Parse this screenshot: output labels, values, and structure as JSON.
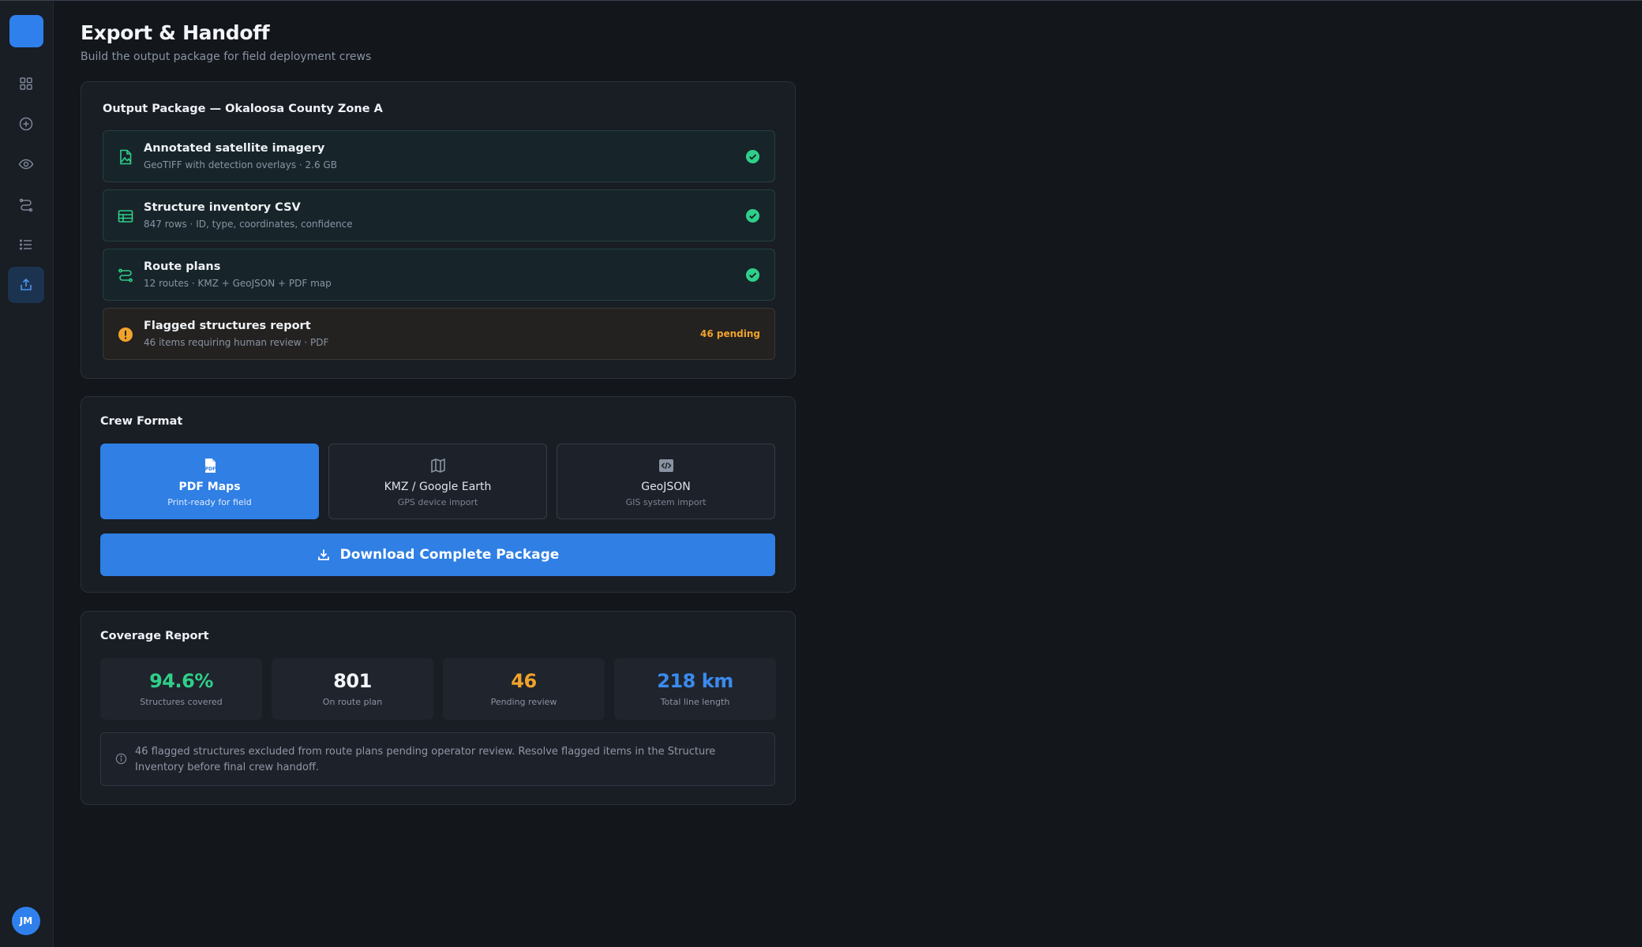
{
  "sidebar": {
    "items": [
      {
        "icon": "dashboard-grid-icon"
      },
      {
        "icon": "plus-circle-icon"
      },
      {
        "icon": "eye-icon"
      },
      {
        "icon": "route-icon"
      },
      {
        "icon": "list-icon"
      },
      {
        "icon": "export-icon",
        "active": true
      }
    ],
    "avatar_initials": "JM"
  },
  "header": {
    "title": "Export & Handoff",
    "subtitle": "Build the output package for field deployment crews"
  },
  "output_package": {
    "title": "Output Package — Okaloosa County Zone A",
    "items": [
      {
        "icon": "image-file-icon",
        "title": "Annotated satellite imagery",
        "subtitle": "GeoTIFF with detection overlays · 2.6 GB",
        "status": "complete"
      },
      {
        "icon": "table-icon",
        "title": "Structure inventory CSV",
        "subtitle": "847 rows · ID, type, coordinates, confidence",
        "status": "complete"
      },
      {
        "icon": "route-icon",
        "title": "Route plans",
        "subtitle": "12 routes · KMZ + GeoJSON + PDF map",
        "status": "complete"
      },
      {
        "icon": "warning-icon",
        "title": "Flagged structures report",
        "subtitle": "46 items requiring human review · PDF",
        "status": "pending",
        "status_text": "46 pending"
      }
    ]
  },
  "crew_format": {
    "title": "Crew Format",
    "options": [
      {
        "icon": "pdf-icon",
        "label": "PDF Maps",
        "sub": "Print-ready for field",
        "selected": true
      },
      {
        "icon": "map-icon",
        "label": "KMZ / Google Earth",
        "sub": "GPS device import",
        "selected": false
      },
      {
        "icon": "code-icon",
        "label": "GeoJSON",
        "sub": "GIS system import",
        "selected": false
      }
    ],
    "download_label": "Download Complete Package"
  },
  "coverage": {
    "title": "Coverage Report",
    "stats": [
      {
        "value": "94.6%",
        "label": "Structures covered",
        "color": "#2fcf8a"
      },
      {
        "value": "801",
        "label": "On route plan",
        "color": "#f3f5f8"
      },
      {
        "value": "46",
        "label": "Pending review",
        "color": "#f0a32a"
      },
      {
        "value": "218 km",
        "label": "Total line length",
        "color": "#3a8bef"
      }
    ],
    "note": "46 flagged structures excluded from route plans pending operator review. Resolve flagged items in the Structure Inventory before final crew handoff."
  },
  "colors": {
    "accent": "#2f80ec",
    "success": "#2fcf8a",
    "warning": "#f0a32a",
    "background": "#13161b"
  }
}
